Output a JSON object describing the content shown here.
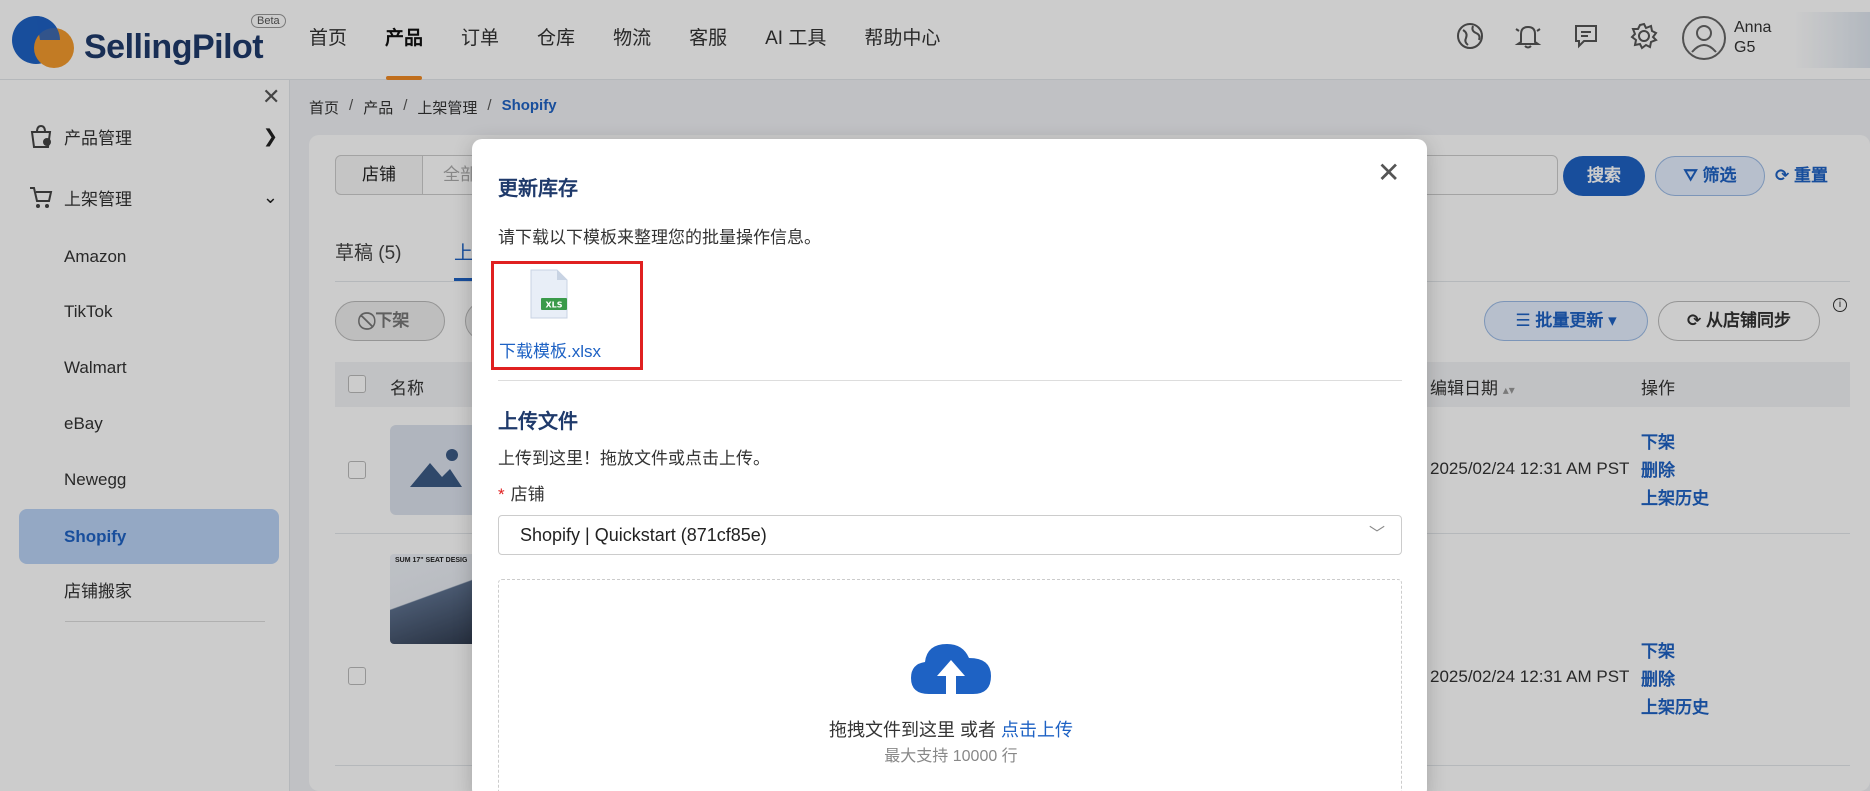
{
  "header": {
    "brand": "SellingPilot",
    "beta": "Beta",
    "nav": [
      "首页",
      "产品",
      "订单",
      "仓库",
      "物流",
      "客服",
      "AI 工具",
      "帮助中心"
    ],
    "active_nav": "产品",
    "icons": [
      "globe-icon",
      "bell-icon",
      "feedback-icon",
      "gear-icon"
    ],
    "user_name_1": "Anna",
    "user_name_2": "G5"
  },
  "sidebar": {
    "group_product": "产品管理",
    "group_listing": "上架管理",
    "items": [
      "Amazon",
      "TikTok",
      "Walmart",
      "eBay",
      "Newegg",
      "Shopify",
      "店铺搬家"
    ],
    "active_item": "Shopify"
  },
  "breadcrumb": [
    "首页",
    "产品",
    "上架管理",
    "Shopify"
  ],
  "filters": {
    "store_label": "店铺",
    "store_value": "全部",
    "search": "搜索",
    "filter": "筛选",
    "reset": "重置"
  },
  "tabs": {
    "draft": "草稿 (5)",
    "listed_partial": "上"
  },
  "actions": {
    "offline": "下架",
    "batch_update": "批量更新",
    "sync": "从店铺同步",
    "info": "i"
  },
  "table": {
    "col_name": "名称",
    "col_edit_date": "编辑日期",
    "col_actions": "操作",
    "rows": [
      {
        "date": "2025/02/24 12:31 AM PST",
        "actions": [
          "下架",
          "删除",
          "上架历史"
        ]
      },
      {
        "date": "2025/02/24 12:31 AM PST",
        "actions": [
          "下架",
          "删除",
          "上架历史"
        ],
        "thumb_label": "SUM 17\" SEAT DESIG"
      }
    ]
  },
  "modal": {
    "title": "更新库存",
    "close": "✕",
    "description": "请下载以下模板来整理您的批量操作信息。",
    "file_badge": "XLS",
    "download_link": "下载模板.xlsx",
    "upload_title": "上传文件",
    "upload_description": "上传到这里！拖放文件或点击上传。",
    "store_required_mark": "*",
    "store_label": "店铺",
    "store_value": "Shopify | Quickstart (871cf85e)",
    "drop_text": "拖拽文件到这里 或者",
    "drop_link": "点击上传",
    "drop_hint": "最大支持 10000 行"
  },
  "colors": {
    "accent": "#1e62c4",
    "brand_dark": "#1f3a6b",
    "nav_active_underline": "#f08a24",
    "highlight_border": "#e02020"
  }
}
